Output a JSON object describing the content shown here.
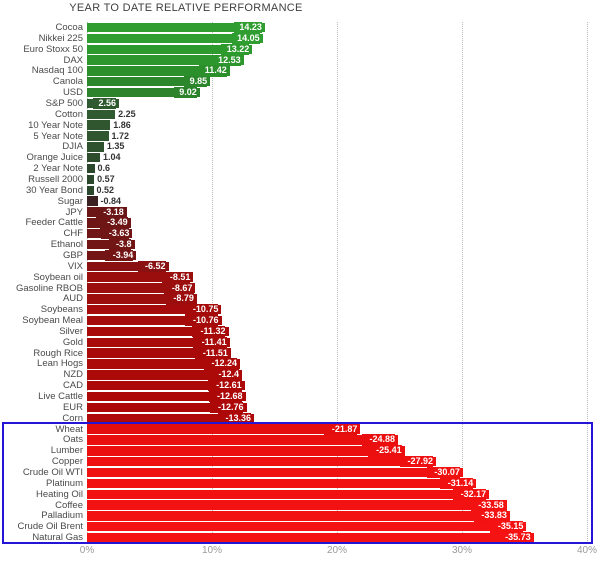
{
  "chart_data": {
    "type": "bar",
    "orientation": "horizontal",
    "title": "YEAR TO DATE RELATIVE PERFORMANCE",
    "xlabel": "",
    "ylabel": "",
    "xlim": [
      0,
      40
    ],
    "grid": true,
    "grid_axis": "x",
    "legend": "none",
    "axis_ticks": [
      "0%",
      "10%",
      "20%",
      "30%",
      "40%"
    ],
    "axis_tick_values": [
      0,
      10,
      20,
      30,
      40
    ],
    "note": "Bar lengths drawn from the absolute value of each percent change; positive values are green, negative values are red.",
    "categories": [
      "Cocoa",
      "Nikkei 225",
      "Euro Stoxx 50",
      "DAX",
      "Nasdaq 100",
      "Canola",
      "USD",
      "S&P 500",
      "Cotton",
      "10 Year Note",
      "5 Year Note",
      "DJIA",
      "Orange Juice",
      "2 Year Note",
      "Russell 2000",
      "30 Year Bond",
      "Sugar",
      "JPY",
      "Feeder Cattle",
      "CHF",
      "Ethanol",
      "GBP",
      "VIX",
      "Soybean oil",
      "Gasoline RBOB",
      "AUD",
      "Soybeans",
      "Soybean Meal",
      "Silver",
      "Gold",
      "Rough Rice",
      "Lean Hogs",
      "NZD",
      "CAD",
      "Live Cattle",
      "EUR",
      "Corn",
      "Wheat",
      "Oats",
      "Lumber",
      "Copper",
      "Crude Oil WTI",
      "Platinum",
      "Heating Oil",
      "Coffee",
      "Palladium",
      "Crude Oil Brent",
      "Natural Gas"
    ],
    "values": [
      14.23,
      14.05,
      13.22,
      12.53,
      11.42,
      9.85,
      9.02,
      2.56,
      2.25,
      1.86,
      1.72,
      1.35,
      1.04,
      0.6,
      0.57,
      0.52,
      -0.84,
      -3.18,
      -3.49,
      -3.63,
      -3.8,
      -3.94,
      -6.52,
      -8.51,
      -8.67,
      -8.79,
      -10.75,
      -10.76,
      -11.32,
      -11.41,
      -11.51,
      -12.24,
      -12.4,
      -12.61,
      -12.68,
      -12.76,
      -13.36,
      -21.87,
      -24.88,
      -25.41,
      -27.92,
      -30.07,
      -31.14,
      -32.17,
      -33.58,
      -33.83,
      -35.15,
      -35.73
    ],
    "value_labels": [
      "14.23",
      "14.05",
      "13.22",
      "12.53",
      "11.42",
      "9.85",
      "9.02",
      "2.56",
      "2.25",
      "1.86",
      "1.72",
      "1.35",
      "1.04",
      "0.6",
      "0.57",
      "0.52",
      "-0.84",
      "-3.18",
      "-3.49",
      "-3.63",
      "-3.8",
      "-3.94",
      "-6.52",
      "-8.51",
      "-8.67",
      "-8.79",
      "-10.75",
      "-10.76",
      "-11.32",
      "-11.41",
      "-11.51",
      "-12.24",
      "-12.4",
      "-12.61",
      "-12.68",
      "-12.76",
      "-13.36",
      "-21.87",
      "-24.88",
      "-25.41",
      "-27.92",
      "-30.07",
      "-31.14",
      "-32.17",
      "-33.58",
      "-33.83",
      "-35.15",
      "-35.73"
    ],
    "bar_colors": [
      "#2f9d2f",
      "#2f9d2f",
      "#2d9a2d",
      "#2d962d",
      "#2b8f2b",
      "#2c862c",
      "#2c832c",
      "#2f5a2f",
      "#305a30",
      "#2f562f",
      "#2f562f",
      "#2e512e",
      "#2d4d2d",
      "#2c482c",
      "#2c482c",
      "#2c482c",
      "#3a2020",
      "#6b1616",
      "#6e1616",
      "#701616",
      "#721515",
      "#741515",
      "#8a1111",
      "#9a0e0e",
      "#9b0e0e",
      "#9c0e0e",
      "#a50b0b",
      "#a50b0b",
      "#a80a0a",
      "#a80a0a",
      "#a80a0a",
      "#ac0909",
      "#ac0909",
      "#ad0808",
      "#ad0808",
      "#ad0808",
      "#ae0808",
      "#e40e0e",
      "#ea0f0f",
      "#eb0f0f",
      "#ee1010",
      "#f01111",
      "#f11111",
      "#f21111",
      "#f31212",
      "#f31212",
      "#f41212",
      "#f41212"
    ]
  },
  "highlight": {
    "name": "selection-box",
    "color": "#2414d6",
    "first_category": "Wheat",
    "last_category": "Natural Gas"
  }
}
